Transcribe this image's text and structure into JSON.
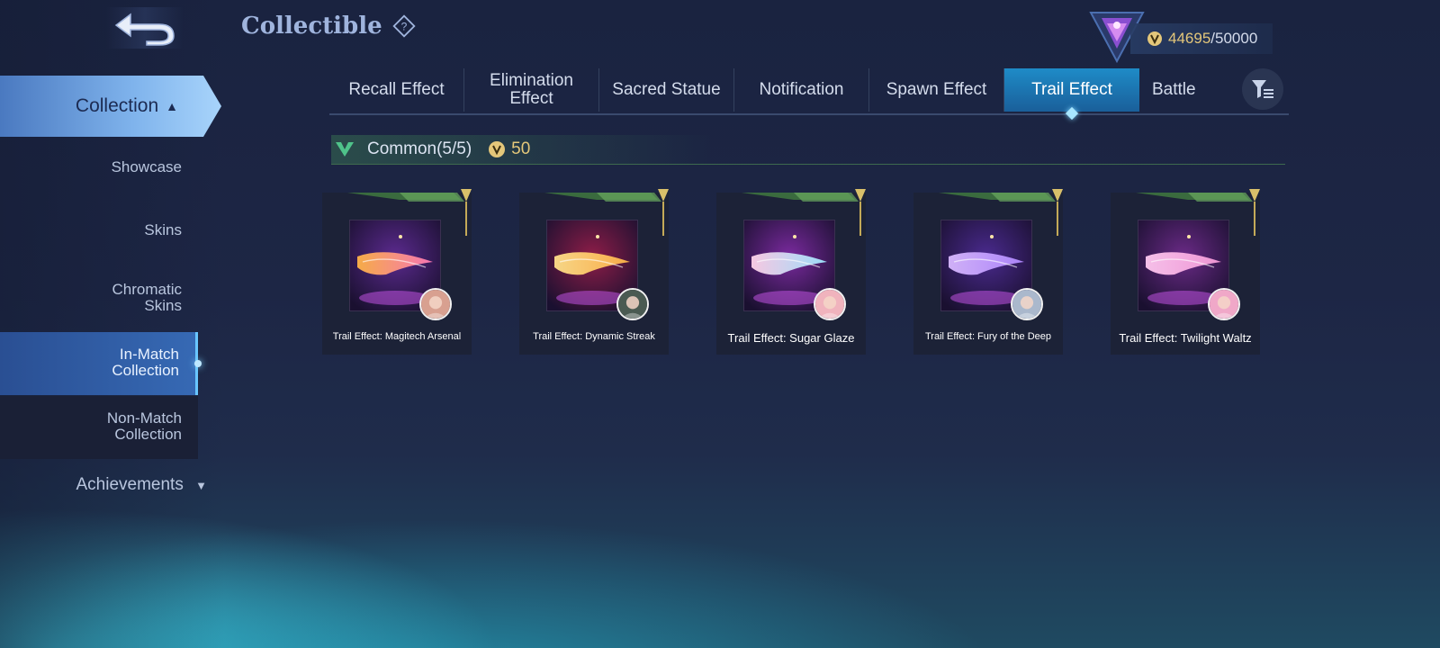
{
  "header": {
    "title": "Collectible",
    "points_current": "44695",
    "points_max": "/50000",
    "help_icon": "question-diamond-icon",
    "back_icon": "back-arrow-icon"
  },
  "sidebar": {
    "collection_label": "Collection",
    "sub_items": [
      {
        "label_lines": [
          "Showcase"
        ]
      },
      {
        "label_lines": [
          "Skins"
        ]
      },
      {
        "label_lines": [
          "Chromatic",
          "Skins"
        ]
      },
      {
        "label_lines": [
          "In-Match",
          "Collection"
        ],
        "active": true
      },
      {
        "label_lines": [
          "Non-Match",
          "Collection"
        ]
      }
    ],
    "achievements_label": "Achievements"
  },
  "tabs": [
    {
      "label_lines": [
        "Recall Effect"
      ]
    },
    {
      "label_lines": [
        "Elimination",
        "Effect"
      ]
    },
    {
      "label_lines": [
        "Sacred Statue"
      ]
    },
    {
      "label_lines": [
        "Notification"
      ]
    },
    {
      "label_lines": [
        "Spawn Effect"
      ]
    },
    {
      "label_lines": [
        "Trail Effect"
      ],
      "active": true
    },
    {
      "label_lines": [
        "Battle"
      ]
    }
  ],
  "section": {
    "label": "Common(5/5)",
    "value": "50"
  },
  "items": [
    {
      "name": "Trail Effect: Magitech Arsenal",
      "bg": "#5b2a8e",
      "trail": [
        "#ffb347",
        "#ff7ab8"
      ],
      "avatar": "#d8a090"
    },
    {
      "name": "Trail Effect: Dynamic Streak",
      "bg": "#8e1d48",
      "trail": [
        "#ffe08a",
        "#ffb347"
      ],
      "avatar": "#4a5a52"
    },
    {
      "name": "Trail Effect: Sugar Glaze",
      "bg": "#7a2a9e",
      "trail": [
        "#ffd1e8",
        "#9ee6ff"
      ],
      "avatar": "#f0b3bd"
    },
    {
      "name": "Trail Effect: Fury of the Deep",
      "bg": "#4a2a8e",
      "trail": [
        "#d8b8ff",
        "#b088ff"
      ],
      "avatar": "#aab8cc"
    },
    {
      "name": "Trail Effect: Twilight Waltz",
      "bg": "#6a2a86",
      "trail": [
        "#ffc8f0",
        "#f59ad8"
      ],
      "avatar": "#f0a8c8"
    }
  ],
  "colors": {
    "gold": "#e4c77a",
    "active_tab": "#1e8bc7",
    "active_nav": "#3669b4"
  }
}
